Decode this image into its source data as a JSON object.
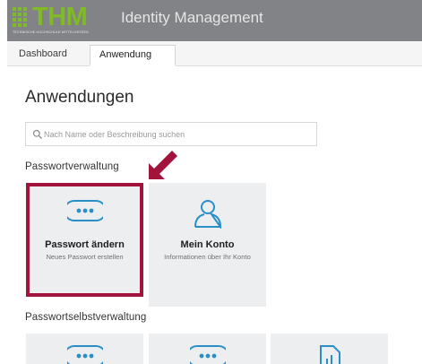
{
  "header": {
    "logo_text": "THM",
    "logo_subtitle": "TECHNISCHE HOCHSCHULE MITTELHESSEN",
    "app_title": "Identity Management"
  },
  "tabs": [
    {
      "label": "Dashboard",
      "active": false
    },
    {
      "label": "Anwendung",
      "active": true
    }
  ],
  "main": {
    "title": "Anwendungen",
    "search_placeholder": "Nach Name oder Beschreibung suchen",
    "sections": [
      {
        "title": "Passwortverwaltung",
        "tiles": [
          {
            "icon": "password-dots-icon",
            "title": "Passwort ändern",
            "description": "Neues Passwort erstellen",
            "highlighted": true
          },
          {
            "icon": "user-icon",
            "title": "Mein Konto",
            "description": "Informationen über Ihr Konto",
            "highlighted": false
          }
        ]
      },
      {
        "title": "Passwortselbstverwaltung",
        "tiles": [
          {
            "icon": "password-dots-icon"
          },
          {
            "icon": "password-dots-icon"
          },
          {
            "icon": "document-chart-icon"
          }
        ]
      }
    ]
  },
  "colors": {
    "brand_green": "#80ba24",
    "header_gray": "#818387",
    "highlight": "#a3143c",
    "accent_blue": "#2a8fc9"
  }
}
